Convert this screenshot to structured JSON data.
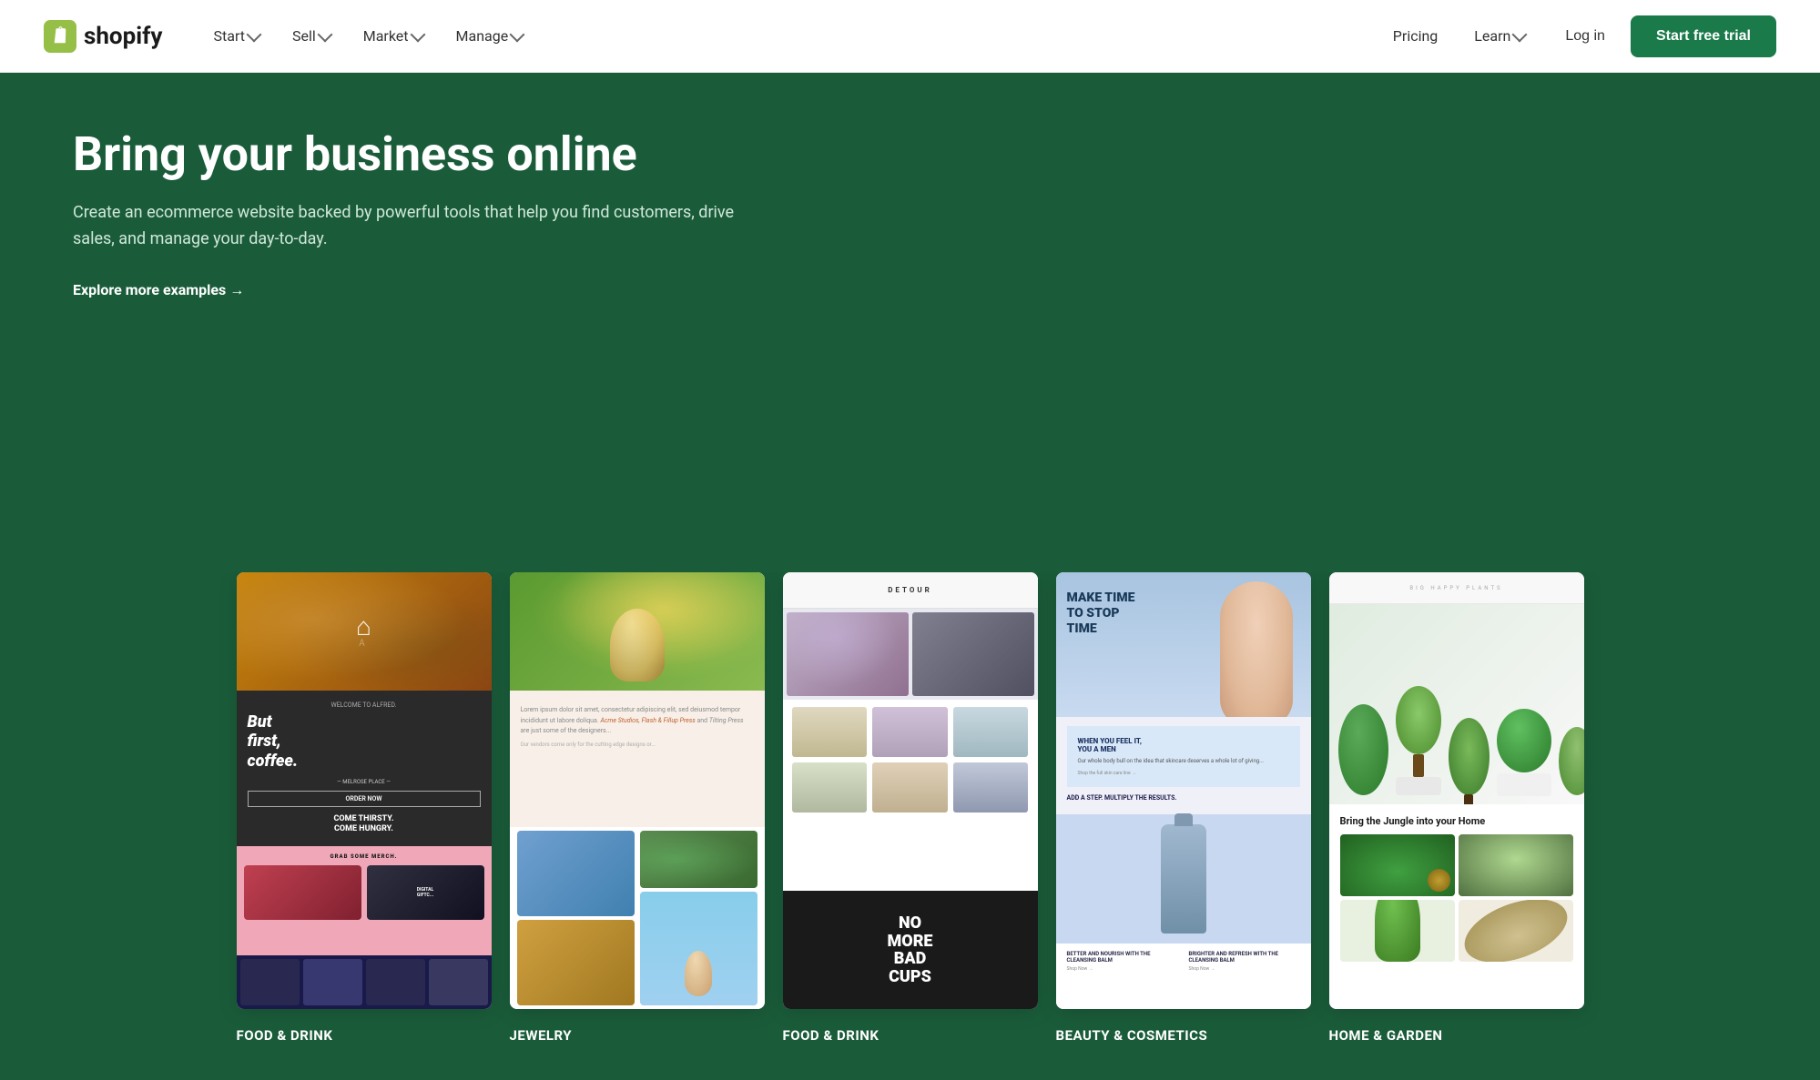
{
  "nav": {
    "logo_text": "shopify",
    "items_left": [
      {
        "label": "Start",
        "has_dropdown": true
      },
      {
        "label": "Sell",
        "has_dropdown": true
      },
      {
        "label": "Market",
        "has_dropdown": true
      },
      {
        "label": "Manage",
        "has_dropdown": true
      }
    ],
    "items_right": [
      {
        "label": "Pricing",
        "has_dropdown": false
      },
      {
        "label": "Learn",
        "has_dropdown": true
      }
    ],
    "login_label": "Log in",
    "trial_label": "Start free trial"
  },
  "hero": {
    "title": "Bring your business online",
    "subtitle": "Create an ecommerce website backed by powerful tools that help you find customers, drive sales, and manage your day-to-day.",
    "link_text": "Explore more examples →"
  },
  "cards": [
    {
      "category": "FOOD & DRINK",
      "type": "food"
    },
    {
      "category": "JEWELRY",
      "type": "jewelry"
    },
    {
      "category": "FOOD & DRINK",
      "type": "detour"
    },
    {
      "category": "BEAUTY & COSMETICS",
      "type": "beauty"
    },
    {
      "category": "HOME & GARDEN",
      "type": "garden"
    }
  ],
  "food_card": {
    "title": "But first, coffee.",
    "welcome": "WELCOME TO ALFRED.",
    "location": "MELROSE PLACE",
    "tagline": "COME THIRSTY. COME HUNGRY.",
    "merch": "GRAB SOME MERCH.",
    "detour_name": "DETOUR",
    "detour_tagline": "NO MORE BAD CUPS"
  },
  "beauty_card": {
    "headline": "MAKE TIME TO STOP TIME",
    "subheadline": "WHEN YOU FEEL IT, YOU A MEN",
    "tagline1": "BETTER AND NOURISH WITH THE CLEANSING BALM",
    "tagline2": "BRIGHTER AND REFRESH WITH THE CLEANSING BALM"
  },
  "garden_card": {
    "header_text": "Bring the Jungle into your Home"
  }
}
